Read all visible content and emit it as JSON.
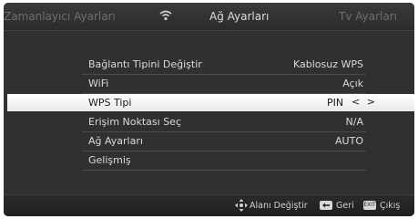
{
  "tabs": {
    "left": "Zamanlayıcı Ayarları",
    "center": "Ağ Ayarları",
    "right": "Tv Ayarları"
  },
  "menu": {
    "rows": [
      {
        "label": "Bağlantı Tipini Değiştir",
        "value": "Kablosuz WPS"
      },
      {
        "label": "WiFi",
        "value": "Açık"
      },
      {
        "label": "WPS Tipi",
        "value": "PIN",
        "arrows": "< >",
        "selected": true
      },
      {
        "label": "Erişim Noktası Seç",
        "value": "N/A"
      },
      {
        "label": "Ağ Ayarları",
        "value": "AUTO"
      },
      {
        "label": "Gelişmiş",
        "value": ""
      }
    ]
  },
  "footer": {
    "change_area": "Alanı Değiştir",
    "back": "Geri",
    "exit_key": "EXIT",
    "exit": "Çıkış"
  },
  "icons": {
    "wifi": "wifi-icon",
    "navigate": "dpad-icon",
    "back": "back-key-icon",
    "exit": "exit-key-icon"
  },
  "colors": {
    "background": "#303030",
    "selected_row": "#f4f4f4",
    "text": "#dadada",
    "inactive_tab": "#6e6e6e"
  }
}
